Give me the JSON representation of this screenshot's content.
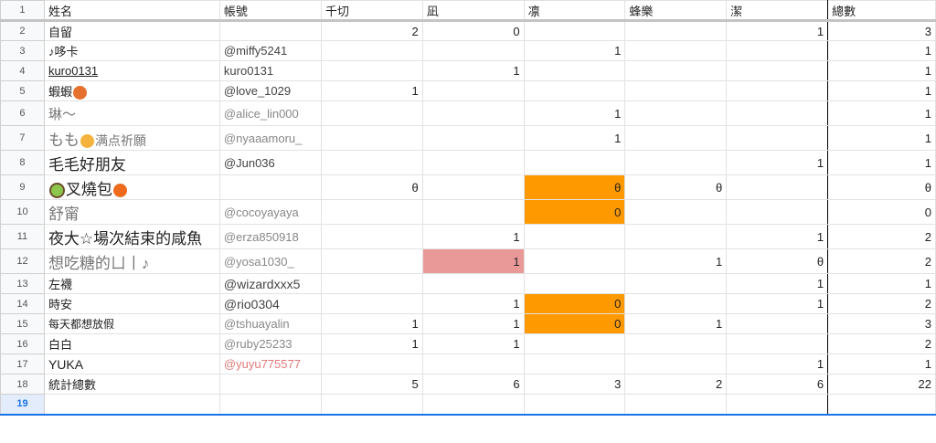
{
  "headers": [
    "姓名",
    "帳號",
    "千切",
    "凪",
    "凛",
    "蜂樂",
    "潔",
    "總數"
  ],
  "rows": [
    {
      "num": "2",
      "name": "自留",
      "handle": "",
      "c": [
        "2",
        "0",
        "",
        "",
        "1"
      ],
      "total": "3"
    },
    {
      "num": "3",
      "name": "♪哆卡",
      "handle": "@miffy5241",
      "c": [
        "",
        "",
        "1",
        "",
        ""
      ],
      "total": "1"
    },
    {
      "num": "4",
      "name": "kuro0131",
      "handle": "kuro0131",
      "c": [
        "",
        "1",
        "",
        "",
        ""
      ],
      "total": "1"
    },
    {
      "num": "5",
      "name": "蝦蝦",
      "handle": "@love_1029",
      "c": [
        "1",
        "",
        "",
        "",
        ""
      ],
      "total": "1"
    },
    {
      "num": "6",
      "name": "琳～",
      "handle": "@alice_lin000",
      "c": [
        "",
        "",
        "1",
        "",
        ""
      ],
      "total": "1"
    },
    {
      "num": "7",
      "name": "もも",
      "name2": "满点祈願",
      "handle": "@nyaaamoru_",
      "c": [
        "",
        "",
        "1",
        "",
        ""
      ],
      "total": "1"
    },
    {
      "num": "8",
      "name": "毛毛好朋友",
      "handle": "@Jun036",
      "c": [
        "",
        "",
        "",
        "",
        "1"
      ],
      "total": "1"
    },
    {
      "num": "9",
      "name": "叉燒包",
      "handle": "",
      "c": [
        "θ",
        "",
        "θ",
        "θ",
        ""
      ],
      "total": "θ"
    },
    {
      "num": "10",
      "name": "舒甯",
      "handle": "@cocoyayaya",
      "c": [
        "",
        "",
        "0",
        "",
        ""
      ],
      "total": "0"
    },
    {
      "num": "11",
      "name": "夜大☆場次結束的咸魚",
      "handle": "@erza850918",
      "c": [
        "",
        "1",
        "",
        "",
        "1"
      ],
      "total": "2"
    },
    {
      "num": "12",
      "name": "想吃糖的ㄩ丨♪",
      "handle": "@yosa1030_",
      "c": [
        "",
        "1",
        "",
        "1",
        "θ"
      ],
      "total": "2"
    },
    {
      "num": "13",
      "name": "左襪",
      "handle": "@wizardxxx5",
      "c": [
        "",
        "",
        "",
        "",
        "1"
      ],
      "total": "1"
    },
    {
      "num": "14",
      "name": "時安",
      "handle": "@rio0304",
      "c": [
        "",
        "1",
        "0",
        "",
        "1"
      ],
      "total": "2"
    },
    {
      "num": "15",
      "name": "每天都想放假",
      "handle": "@tshuayalin",
      "c": [
        "1",
        "1",
        "0",
        "1",
        ""
      ],
      "total": "3"
    },
    {
      "num": "16",
      "name": "白白",
      "handle": "@ruby25233",
      "c": [
        "1",
        "1",
        "",
        "",
        ""
      ],
      "total": "2"
    },
    {
      "num": "17",
      "name": "YUKA",
      "handle": "@yuyu775577",
      "c": [
        "",
        "",
        "",
        "",
        "1"
      ],
      "total": "1"
    }
  ],
  "totals": {
    "num": "18",
    "label": "統計總數",
    "c": [
      "5",
      "6",
      "3",
      "2",
      "6"
    ],
    "total": "22"
  },
  "selected_row": "19",
  "header_row_num": "1",
  "icons": {
    "shrimp": "shrimp-emoji-icon",
    "cat": "cat-face-emoji-icon",
    "fox": "fox-emoji-icon",
    "cup": "matcha-cup-emoji-icon"
  },
  "colors": {
    "orange": "#ff9900",
    "rose": "#ea9999"
  }
}
